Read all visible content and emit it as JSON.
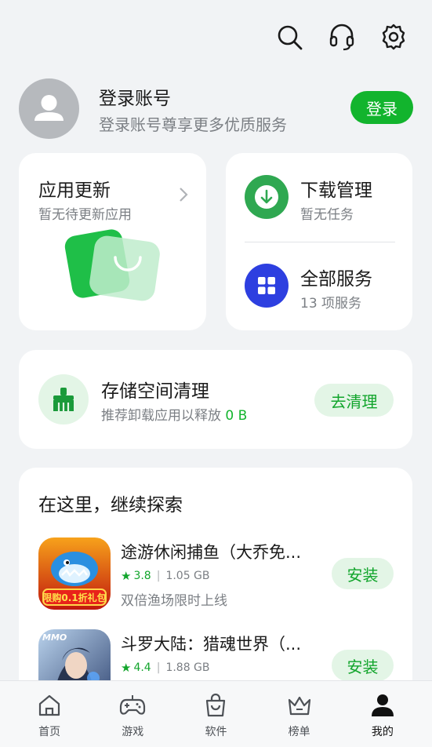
{
  "top_icons": [
    "search-icon",
    "headset-icon",
    "settings-icon"
  ],
  "account": {
    "title": "登录账号",
    "subtitle": "登录账号尊享更多优质服务",
    "login_label": "登录"
  },
  "update_card": {
    "title": "应用更新",
    "subtitle": "暂无待更新应用"
  },
  "download_card": {
    "title": "下载管理",
    "subtitle": "暂无任务"
  },
  "services_card": {
    "title": "全部服务",
    "subtitle": "13 项服务"
  },
  "storage_card": {
    "title": "存储空间清理",
    "subtitle_prefix": "推荐卸载应用以释放",
    "freeable": "0 B",
    "button_label": "去清理"
  },
  "explore": {
    "title": "在这里，继续探索",
    "apps": [
      {
        "name": "途游休闲捕鱼（大乔免...",
        "rating": "3.8",
        "size": "1.05 GB",
        "description": "双倍渔场限时上线",
        "install_label": "安装",
        "icon_badge": "限购0.1折礼包"
      },
      {
        "name": "斗罗大陆：猎魂世界（...",
        "rating": "4.4",
        "size": "1.88 GB",
        "description": "",
        "install_label": "安装",
        "icon_badge": "MMO"
      }
    ]
  },
  "bottom_nav": [
    {
      "label": "首页",
      "icon": "home-icon"
    },
    {
      "label": "游戏",
      "icon": "gamepad-icon"
    },
    {
      "label": "软件",
      "icon": "bag-icon"
    },
    {
      "label": "榜单",
      "icon": "crown-icon"
    },
    {
      "label": "我的",
      "icon": "person-icon",
      "active": true
    }
  ],
  "colors": {
    "accent": "#12b42d",
    "download_icon_bg": "#2fa851",
    "services_icon_bg": "#2d3fe0",
    "background": "#f1f3f5"
  }
}
